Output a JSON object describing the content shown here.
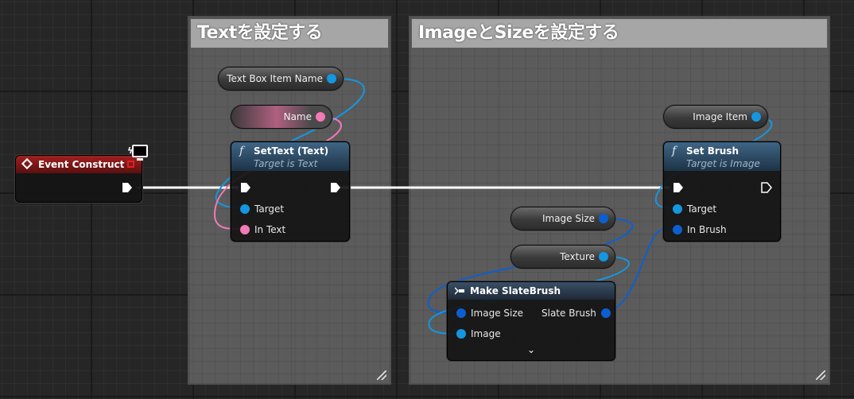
{
  "comments": {
    "text_section": {
      "title": "Textを設定する"
    },
    "image_section": {
      "title": "ImageとSizeを設定する"
    }
  },
  "nodes": {
    "event_construct": {
      "title": "Event Construct"
    },
    "text_box_var": {
      "label": "Text Box Item Name"
    },
    "name_var": {
      "label": "Name"
    },
    "set_text": {
      "title": "SetText (Text)",
      "subtitle": "Target is Text",
      "target_label": "Target",
      "in_text_label": "In Text"
    },
    "image_item_var": {
      "label": "Image Item"
    },
    "set_brush": {
      "title": "Set Brush",
      "subtitle": "Target is Image",
      "target_label": "Target",
      "in_brush_label": "In Brush"
    },
    "image_size_var": {
      "label": "Image Size"
    },
    "texture_var": {
      "label": "Texture"
    },
    "make_slate_brush": {
      "title": "Make SlateBrush",
      "image_size_label": "Image Size",
      "image_label": "Image",
      "slate_brush_label": "Slate Brush",
      "expand_glyph": "⌄"
    }
  },
  "icons": {
    "function": "function-icon",
    "event": "event-diamond-icon",
    "monitor": "monitor-icon",
    "make_struct": "make-struct-icon"
  },
  "colors": {
    "object_pin": "#1596e0",
    "struct_pin": "#0d5fd0",
    "text_pin": "#f27ab5",
    "exec_wire": "#ffffff",
    "event_header": "#a02020",
    "function_header": "#3f6585"
  }
}
